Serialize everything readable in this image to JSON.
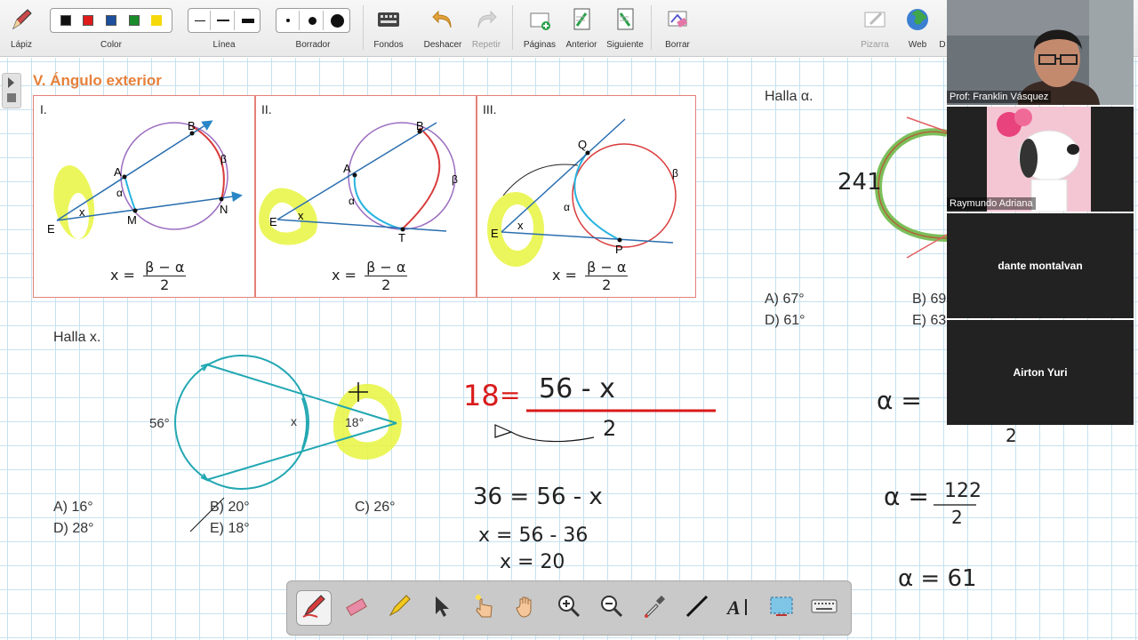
{
  "toolbar": {
    "pen_label": "Lápiz",
    "color_label": "Color",
    "line_label": "Línea",
    "eraser_label": "Borrador",
    "backgrounds_label": "Fondos",
    "undo_label": "Deshacer",
    "redo_label": "Repetir",
    "pages_label": "Páginas",
    "prev_label": "Anterior",
    "next_label": "Siguiente",
    "clear_label": "Borrar",
    "whiteboard_label": "Pizarra",
    "web_label": "Web",
    "cut_label": "D",
    "colors": [
      "#111111",
      "#e01b1b",
      "#1c4f9c",
      "#1a8c2a",
      "#f5d90a"
    ]
  },
  "section": {
    "title": "V. Ángulo exterior",
    "panels": [
      {
        "roman": "I.",
        "labels": [
          "A",
          "B",
          "M",
          "N",
          "E",
          "x",
          "α",
          "β"
        ],
        "formula": {
          "lhs": "x =",
          "num": "β − α",
          "den": "2"
        }
      },
      {
        "roman": "II.",
        "labels": [
          "A",
          "B",
          "T",
          "E",
          "x",
          "α",
          "β"
        ],
        "formula": {
          "lhs": "x =",
          "num": "β − α",
          "den": "2"
        }
      },
      {
        "roman": "III.",
        "labels": [
          "Q",
          "P",
          "E",
          "x",
          "α",
          "β"
        ],
        "formula": {
          "lhs": "x =",
          "num": "β − α",
          "den": "2"
        }
      }
    ]
  },
  "problem1": {
    "prompt": "Halla x.",
    "arc_label": "56°",
    "x_label": "x",
    "angle_label": "18°",
    "options": [
      "A) 16°",
      "B) 20°",
      "C) 26°",
      "D) 28°",
      "E) 18°"
    ]
  },
  "problem2": {
    "prompt": "Halla α.",
    "handwritten_arc": "241",
    "options": [
      "A) 67°",
      "B) 69",
      "D) 61°",
      "E) 63"
    ]
  },
  "handwriting": {
    "eq1_left": "18",
    "eq1_eq": "=",
    "eq1_num": "56 - x",
    "eq1_den": "2",
    "eq2": "36  =  56 - x",
    "eq3": "x  =  56 - 36",
    "eq4": "x = 20",
    "right1": "α  =",
    "right1_den": "2",
    "right2_lhs": "α  =",
    "right2_num": "122",
    "right2_den": "2",
    "right3": "α = 61"
  },
  "participants": [
    {
      "name": "Prof: Franklin Vásquez",
      "type": "video"
    },
    {
      "name": "Raymundo Adriana",
      "type": "image"
    },
    {
      "name": "dante montalvan",
      "type": "text"
    },
    {
      "name": "Airton Yuri",
      "type": "text"
    }
  ]
}
